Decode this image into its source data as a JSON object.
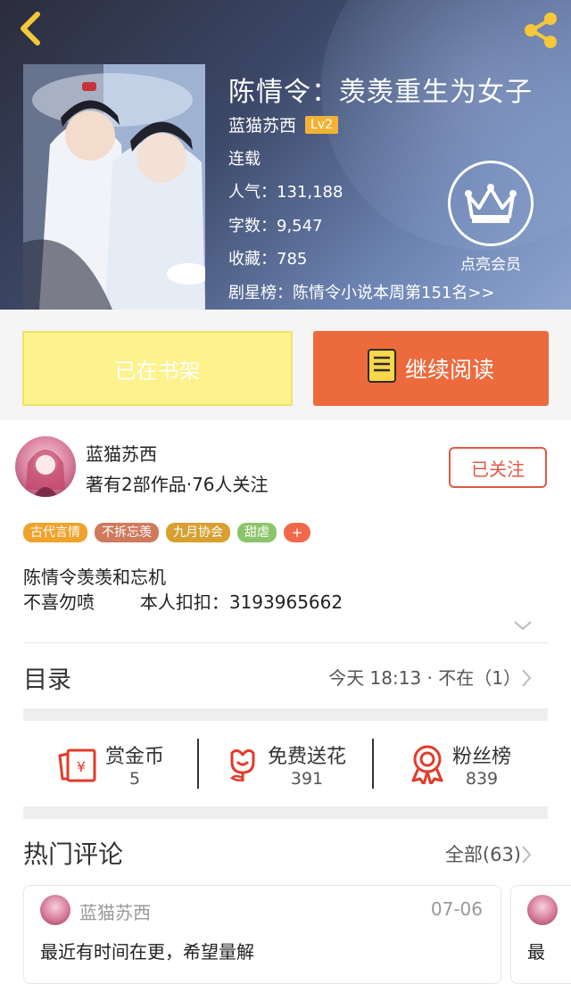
{
  "header": {
    "title": "陈情令：羡羡重生为女子",
    "author": "蓝猫苏西",
    "level": "Lv2",
    "status": "连载",
    "popularity_label": "人气：",
    "popularity": "131,188",
    "words_label": "字数：",
    "words": "9,547",
    "favorites_label": "收藏：",
    "favorites": "785",
    "ranking": "剧星榜：陈情令小说本周第151名>>",
    "vip_label": "点亮会员"
  },
  "actions": {
    "shelf_label": "已在书架",
    "read_label": "继续阅读"
  },
  "author_section": {
    "name": "蓝猫苏西",
    "stats": "著有2部作品·76人关注",
    "follow_label": "已关注",
    "tags": [
      {
        "label": "古代言情",
        "color": "#f0a22b"
      },
      {
        "label": "不拆忘羡",
        "color": "#d07a5c"
      },
      {
        "label": "九月协会",
        "color": "#d8a030"
      },
      {
        "label": "甜虐",
        "color": "#8cc46a"
      }
    ],
    "tag_more": "+",
    "intro_line1": "陈情令羡羡和忘机",
    "intro_line2": "不喜勿喷        本人扣扣：3193965662"
  },
  "catalog": {
    "title": "目录",
    "status": "今天 18:13 · 不在（1）"
  },
  "stats": [
    {
      "label": "赏金币",
      "value": "5",
      "icon": "red-envelope-icon"
    },
    {
      "label": "免费送花",
      "value": "391",
      "icon": "flower-icon"
    },
    {
      "label": "粉丝榜",
      "value": "839",
      "icon": "medal-icon"
    }
  ],
  "comments": {
    "title": "热门评论",
    "all_label": "全部(63)",
    "items": [
      {
        "user": "蓝猫苏西",
        "date": "07-06",
        "text": "最近有时间在更，希望量解"
      },
      {
        "text": "最"
      }
    ]
  },
  "colors": {
    "accent": "#ed6a3d",
    "follow": "#e05a44",
    "shelf": "#fdf28c"
  }
}
